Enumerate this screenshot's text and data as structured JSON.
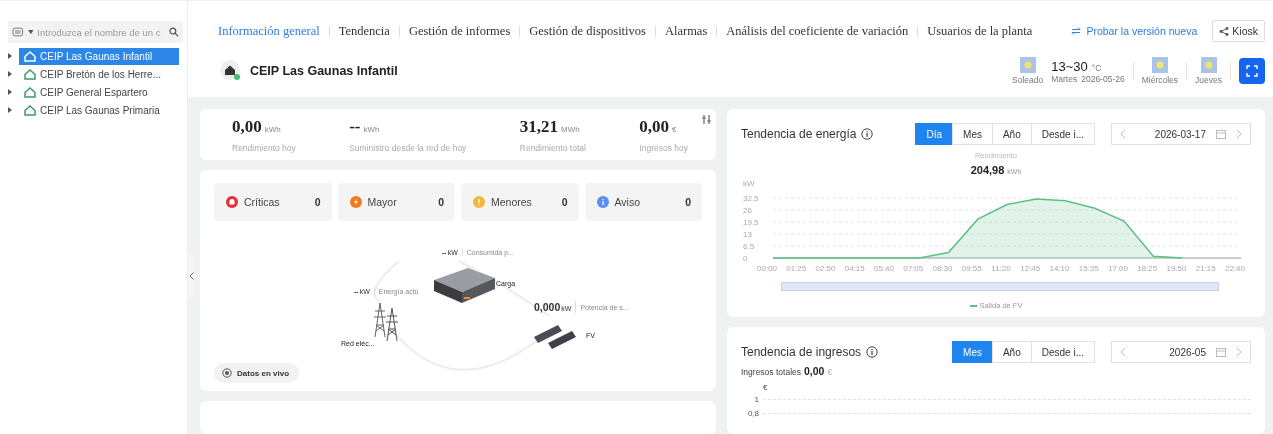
{
  "sidebar": {
    "search": {
      "placeholder": "Introduzca el nombre de un c"
    },
    "items": [
      {
        "label": "CEIP Las Gaunas Infantil",
        "selected": true
      },
      {
        "label": "CEIP Bretón de los Herre...",
        "selected": false
      },
      {
        "label": "CEIP General Espartero",
        "selected": false
      },
      {
        "label": "CEIP Las Gaunas Primaria",
        "selected": false
      }
    ]
  },
  "tabs": [
    {
      "label": "Información general",
      "selected": true
    },
    {
      "label": "Tendencia",
      "selected": false
    },
    {
      "label": "Gestión de informes",
      "selected": false
    },
    {
      "label": "Gestión de dispositivos",
      "selected": false
    },
    {
      "label": "Alarmas",
      "selected": false
    },
    {
      "label": "Análisis del coeficiente de variación",
      "selected": false
    },
    {
      "label": "Usuarios de la planta",
      "selected": false
    }
  ],
  "try_new_link": "Probar la versión nueva",
  "kiosk_button": "Kiosk",
  "plant_title": "CEIP Las Gaunas Infantil",
  "weather": {
    "condition": "Soleado",
    "temp": "13~30",
    "temp_unit": "°C",
    "day": "Martes",
    "date": "2026-05-26",
    "next_days": [
      "Miércoles",
      "Jueves"
    ]
  },
  "kpis": [
    {
      "value": "0,00",
      "unit": "kWh",
      "label": "Rendimiento hoy"
    },
    {
      "value": "--",
      "unit": "kWh",
      "label": "Suministro desde la red de hoy"
    },
    {
      "value": "31,21",
      "unit": "MWh",
      "label": "Rendimiento total"
    },
    {
      "value": "0,00",
      "unit": "€",
      "label": "Ingresos hoy"
    }
  ],
  "alarms": [
    {
      "kind": "critical",
      "label": "Críticas",
      "count": "0",
      "color": "#e0303a"
    },
    {
      "kind": "major",
      "label": "Mayor",
      "count": "0",
      "color": "#f07b1e"
    },
    {
      "kind": "minor",
      "label": "Menores",
      "count": "0",
      "color": "#f5b73b"
    },
    {
      "kind": "warning",
      "label": "Aviso",
      "count": "0",
      "color": "#5b8ff0"
    }
  ],
  "flow": {
    "load": {
      "value": "--",
      "unit": "kW",
      "metric": "Consumida p...",
      "name": "Carga"
    },
    "grid": {
      "value": "--",
      "unit": "kW",
      "metric": "Energía actu",
      "name": "Red eléc..."
    },
    "pv": {
      "value": "0,000",
      "unit": "kW",
      "metric": "Potencia de s...",
      "name": "FV"
    },
    "live_button": "Datos en vivo"
  },
  "energy": {
    "title": "Tendencia de energía",
    "periods": [
      {
        "label": "Día",
        "selected": true
      },
      {
        "label": "Mes",
        "selected": false
      },
      {
        "label": "Año",
        "selected": false
      },
      {
        "label": "Desde i...",
        "selected": false
      }
    ],
    "date": "2026-03-17",
    "summary_label": "Rendimiento",
    "summary_value": "204,98",
    "summary_unit": "kWh",
    "zoom_slider": {
      "level": 1
    },
    "chart_data": {
      "type": "area",
      "grid": true,
      "ylabel": "kW",
      "categories": [
        "00:00",
        "01:25",
        "02:50",
        "04:15",
        "05:40",
        "07:05",
        "08:30",
        "09:55",
        "11:20",
        "12:45",
        "14:10",
        "15:35",
        "17:00",
        "18:25",
        "19:50",
        "21:15",
        "22:40"
      ],
      "series": [
        {
          "name": "Salida de FV",
          "color": "#5cbf85",
          "values": [
            0,
            0,
            0,
            0,
            0,
            0,
            3,
            21,
            29,
            32,
            31,
            27,
            20,
            1,
            0,
            null,
            null
          ]
        }
      ],
      "ylim": [
        0,
        32.5
      ],
      "yticks": [
        0,
        6.5,
        13,
        {
          "value": 19.5,
          "label": "19,5"
        },
        26,
        {
          "value": 32.5,
          "label": "32,5"
        }
      ]
    }
  },
  "income": {
    "title": "Tendencia de ingresos",
    "periods": [
      {
        "label": "Mes",
        "selected": true
      },
      {
        "label": "Año",
        "selected": false
      },
      {
        "label": "Desde i...",
        "selected": false
      }
    ],
    "date": "2026-05",
    "total_label": "Ingresos totales",
    "total_value": "0,00",
    "total_unit": "€",
    "y_unit": "€",
    "y_ticks": [
      "1",
      "0,8"
    ]
  }
}
